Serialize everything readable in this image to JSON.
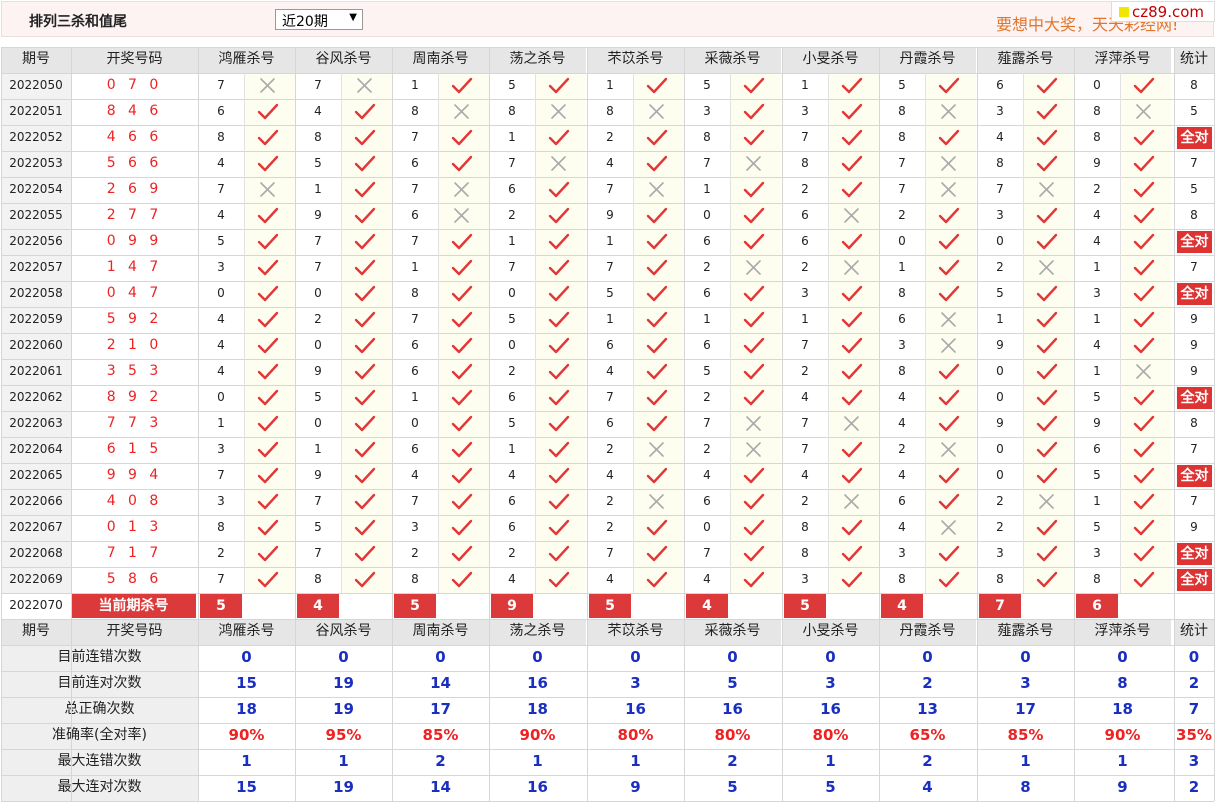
{
  "header": {
    "title": "排列三杀和值尾",
    "select_value": "近20期",
    "slogan": "要想中大奖，天天彩经网!",
    "logo": "cz89.com"
  },
  "columns": {
    "period": "期号",
    "draw": "开奖号码",
    "experts": [
      "鸿雁杀号",
      "谷风杀号",
      "周南杀号",
      "荡之杀号",
      "芣苡杀号",
      "采薇杀号",
      "小旻杀号",
      "丹霞杀号",
      "薤露杀号",
      "浮萍杀号"
    ],
    "stat": "统计"
  },
  "rows": [
    {
      "period": "2022050",
      "draw": "0 7 0",
      "kills": [
        7,
        7,
        1,
        5,
        1,
        5,
        1,
        5,
        6,
        0
      ],
      "hits": [
        0,
        0,
        1,
        1,
        1,
        1,
        1,
        1,
        1,
        1
      ],
      "stat": "8"
    },
    {
      "period": "2022051",
      "draw": "8 4 6",
      "kills": [
        6,
        4,
        8,
        8,
        8,
        3,
        3,
        8,
        3,
        8
      ],
      "hits": [
        1,
        1,
        0,
        0,
        0,
        1,
        1,
        0,
        1,
        0
      ],
      "stat": "5"
    },
    {
      "period": "2022052",
      "draw": "4 6 6",
      "kills": [
        8,
        8,
        7,
        1,
        2,
        8,
        7,
        8,
        4,
        8
      ],
      "hits": [
        1,
        1,
        1,
        1,
        1,
        1,
        1,
        1,
        1,
        1
      ],
      "stat": "全对"
    },
    {
      "period": "2022053",
      "draw": "5 6 6",
      "kills": [
        4,
        5,
        6,
        7,
        4,
        7,
        8,
        7,
        8,
        9
      ],
      "hits": [
        1,
        1,
        1,
        0,
        1,
        0,
        1,
        0,
        1,
        1
      ],
      "stat": "7"
    },
    {
      "period": "2022054",
      "draw": "2 6 9",
      "kills": [
        7,
        1,
        7,
        6,
        7,
        1,
        2,
        7,
        7,
        2
      ],
      "hits": [
        0,
        1,
        0,
        1,
        0,
        1,
        1,
        0,
        0,
        1
      ],
      "stat": "5"
    },
    {
      "period": "2022055",
      "draw": "2 7 7",
      "kills": [
        4,
        9,
        6,
        2,
        9,
        0,
        6,
        2,
        3,
        4
      ],
      "hits": [
        1,
        1,
        0,
        1,
        1,
        1,
        0,
        1,
        1,
        1
      ],
      "stat": "8"
    },
    {
      "period": "2022056",
      "draw": "0 9 9",
      "kills": [
        5,
        7,
        7,
        1,
        1,
        6,
        6,
        0,
        0,
        4
      ],
      "hits": [
        1,
        1,
        1,
        1,
        1,
        1,
        1,
        1,
        1,
        1
      ],
      "stat": "全对"
    },
    {
      "period": "2022057",
      "draw": "1 4 7",
      "kills": [
        3,
        7,
        1,
        7,
        7,
        2,
        2,
        1,
        2,
        1
      ],
      "hits": [
        1,
        1,
        1,
        1,
        1,
        0,
        0,
        1,
        0,
        1
      ],
      "stat": "7"
    },
    {
      "period": "2022058",
      "draw": "0 4 7",
      "kills": [
        0,
        0,
        8,
        0,
        5,
        6,
        3,
        8,
        5,
        3
      ],
      "hits": [
        1,
        1,
        1,
        1,
        1,
        1,
        1,
        1,
        1,
        1
      ],
      "stat": "全对"
    },
    {
      "period": "2022059",
      "draw": "5 9 2",
      "kills": [
        4,
        2,
        7,
        5,
        1,
        1,
        1,
        6,
        1,
        1
      ],
      "hits": [
        1,
        1,
        1,
        1,
        1,
        1,
        1,
        0,
        1,
        1
      ],
      "stat": "9"
    },
    {
      "period": "2022060",
      "draw": "2 1 0",
      "kills": [
        4,
        0,
        6,
        0,
        6,
        6,
        7,
        3,
        9,
        4
      ],
      "hits": [
        1,
        1,
        1,
        1,
        1,
        1,
        1,
        0,
        1,
        1
      ],
      "stat": "9"
    },
    {
      "period": "2022061",
      "draw": "3 5 3",
      "kills": [
        4,
        9,
        6,
        2,
        4,
        5,
        2,
        8,
        0,
        1
      ],
      "hits": [
        1,
        1,
        1,
        1,
        1,
        1,
        1,
        1,
        1,
        0
      ],
      "stat": "9"
    },
    {
      "period": "2022062",
      "draw": "8 9 2",
      "kills": [
        0,
        5,
        1,
        6,
        7,
        2,
        4,
        4,
        0,
        5
      ],
      "hits": [
        1,
        1,
        1,
        1,
        1,
        1,
        1,
        1,
        1,
        1
      ],
      "stat": "全对"
    },
    {
      "period": "2022063",
      "draw": "7 7 3",
      "kills": [
        1,
        0,
        0,
        5,
        6,
        7,
        7,
        4,
        9,
        9
      ],
      "hits": [
        1,
        1,
        1,
        1,
        1,
        0,
        0,
        1,
        1,
        1
      ],
      "stat": "8"
    },
    {
      "period": "2022064",
      "draw": "6 1 5",
      "kills": [
        3,
        1,
        6,
        1,
        2,
        2,
        7,
        2,
        0,
        6
      ],
      "hits": [
        1,
        1,
        1,
        1,
        0,
        0,
        1,
        0,
        1,
        1
      ],
      "stat": "7"
    },
    {
      "period": "2022065",
      "draw": "9 9 4",
      "kills": [
        7,
        9,
        4,
        4,
        4,
        4,
        4,
        4,
        0,
        5
      ],
      "hits": [
        1,
        1,
        1,
        1,
        1,
        1,
        1,
        1,
        1,
        1
      ],
      "stat": "全对"
    },
    {
      "period": "2022066",
      "draw": "4 0 8",
      "kills": [
        3,
        7,
        7,
        6,
        2,
        6,
        2,
        6,
        2,
        1
      ],
      "hits": [
        1,
        1,
        1,
        1,
        0,
        1,
        0,
        1,
        0,
        1
      ],
      "stat": "7"
    },
    {
      "period": "2022067",
      "draw": "0 1 3",
      "kills": [
        8,
        5,
        3,
        6,
        2,
        0,
        8,
        4,
        2,
        5
      ],
      "hits": [
        1,
        1,
        1,
        1,
        1,
        1,
        1,
        0,
        1,
        1
      ],
      "stat": "9"
    },
    {
      "period": "2022068",
      "draw": "7 1 7",
      "kills": [
        2,
        7,
        2,
        2,
        7,
        7,
        8,
        3,
        3,
        3
      ],
      "hits": [
        1,
        1,
        1,
        1,
        1,
        1,
        1,
        1,
        1,
        1
      ],
      "stat": "全对"
    },
    {
      "period": "2022069",
      "draw": "5 8 6",
      "kills": [
        7,
        8,
        8,
        4,
        4,
        4,
        3,
        8,
        8,
        8
      ],
      "hits": [
        1,
        1,
        1,
        1,
        1,
        1,
        1,
        1,
        1,
        1
      ],
      "stat": "全对"
    }
  ],
  "current": {
    "period": "2022070",
    "label": "当前期杀号",
    "kills": [
      5,
      4,
      5,
      9,
      5,
      4,
      5,
      4,
      7,
      6
    ]
  },
  "stats": [
    {
      "label": "目前连错次数",
      "values": [
        "0",
        "0",
        "0",
        "0",
        "0",
        "0",
        "0",
        "0",
        "0",
        "0"
      ],
      "stat": "0",
      "color": "blue"
    },
    {
      "label": "目前连对次数",
      "values": [
        "15",
        "19",
        "14",
        "16",
        "3",
        "5",
        "3",
        "2",
        "3",
        "8"
      ],
      "stat": "2",
      "color": "blue"
    },
    {
      "label": "总正确次数",
      "values": [
        "18",
        "19",
        "17",
        "18",
        "16",
        "16",
        "16",
        "13",
        "17",
        "18"
      ],
      "stat": "7",
      "color": "blue"
    },
    {
      "label": "准确率(全对率)",
      "values": [
        "90%",
        "95%",
        "85%",
        "90%",
        "80%",
        "80%",
        "80%",
        "65%",
        "85%",
        "90%"
      ],
      "stat": "35%",
      "color": "red"
    },
    {
      "label": "最大连错次数",
      "values": [
        "1",
        "1",
        "2",
        "1",
        "1",
        "2",
        "1",
        "2",
        "1",
        "1"
      ],
      "stat": "3",
      "color": "blue"
    },
    {
      "label": "最大连对次数",
      "values": [
        "15",
        "19",
        "14",
        "16",
        "9",
        "5",
        "5",
        "4",
        "8",
        "9"
      ],
      "stat": "2",
      "color": "blue"
    }
  ],
  "colors": {
    "check": "#e33636",
    "cross": "#aaaaaa",
    "current_bg": "#dc3a3a",
    "rate": "#e22222",
    "count": "#1a2fc0"
  }
}
